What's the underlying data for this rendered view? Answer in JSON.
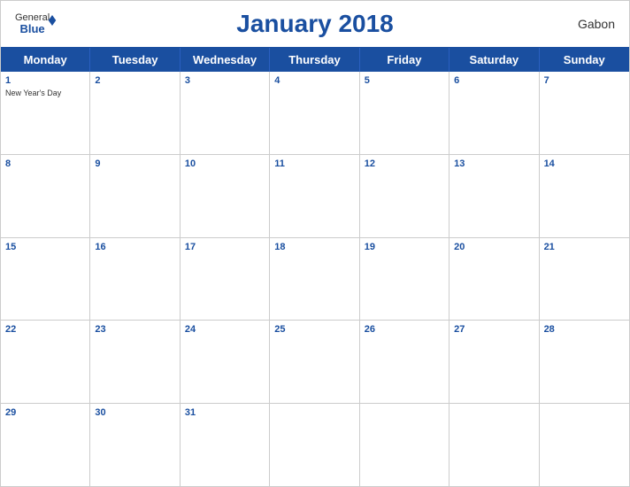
{
  "header": {
    "title": "January 2018",
    "country": "Gabon",
    "logo_general": "General",
    "logo_blue": "Blue"
  },
  "days_of_week": [
    "Monday",
    "Tuesday",
    "Wednesday",
    "Thursday",
    "Friday",
    "Saturday",
    "Sunday"
  ],
  "weeks": [
    [
      {
        "day": 1,
        "holiday": "New Year's Day"
      },
      {
        "day": 2
      },
      {
        "day": 3
      },
      {
        "day": 4
      },
      {
        "day": 5
      },
      {
        "day": 6
      },
      {
        "day": 7
      }
    ],
    [
      {
        "day": 8
      },
      {
        "day": 9
      },
      {
        "day": 10
      },
      {
        "day": 11
      },
      {
        "day": 12
      },
      {
        "day": 13
      },
      {
        "day": 14
      }
    ],
    [
      {
        "day": 15
      },
      {
        "day": 16
      },
      {
        "day": 17
      },
      {
        "day": 18
      },
      {
        "day": 19
      },
      {
        "day": 20
      },
      {
        "day": 21
      }
    ],
    [
      {
        "day": 22
      },
      {
        "day": 23
      },
      {
        "day": 24
      },
      {
        "day": 25
      },
      {
        "day": 26
      },
      {
        "day": 27
      },
      {
        "day": 28
      }
    ],
    [
      {
        "day": 29
      },
      {
        "day": 30
      },
      {
        "day": 31
      },
      {
        "day": null
      },
      {
        "day": null
      },
      {
        "day": null
      },
      {
        "day": null
      }
    ]
  ]
}
